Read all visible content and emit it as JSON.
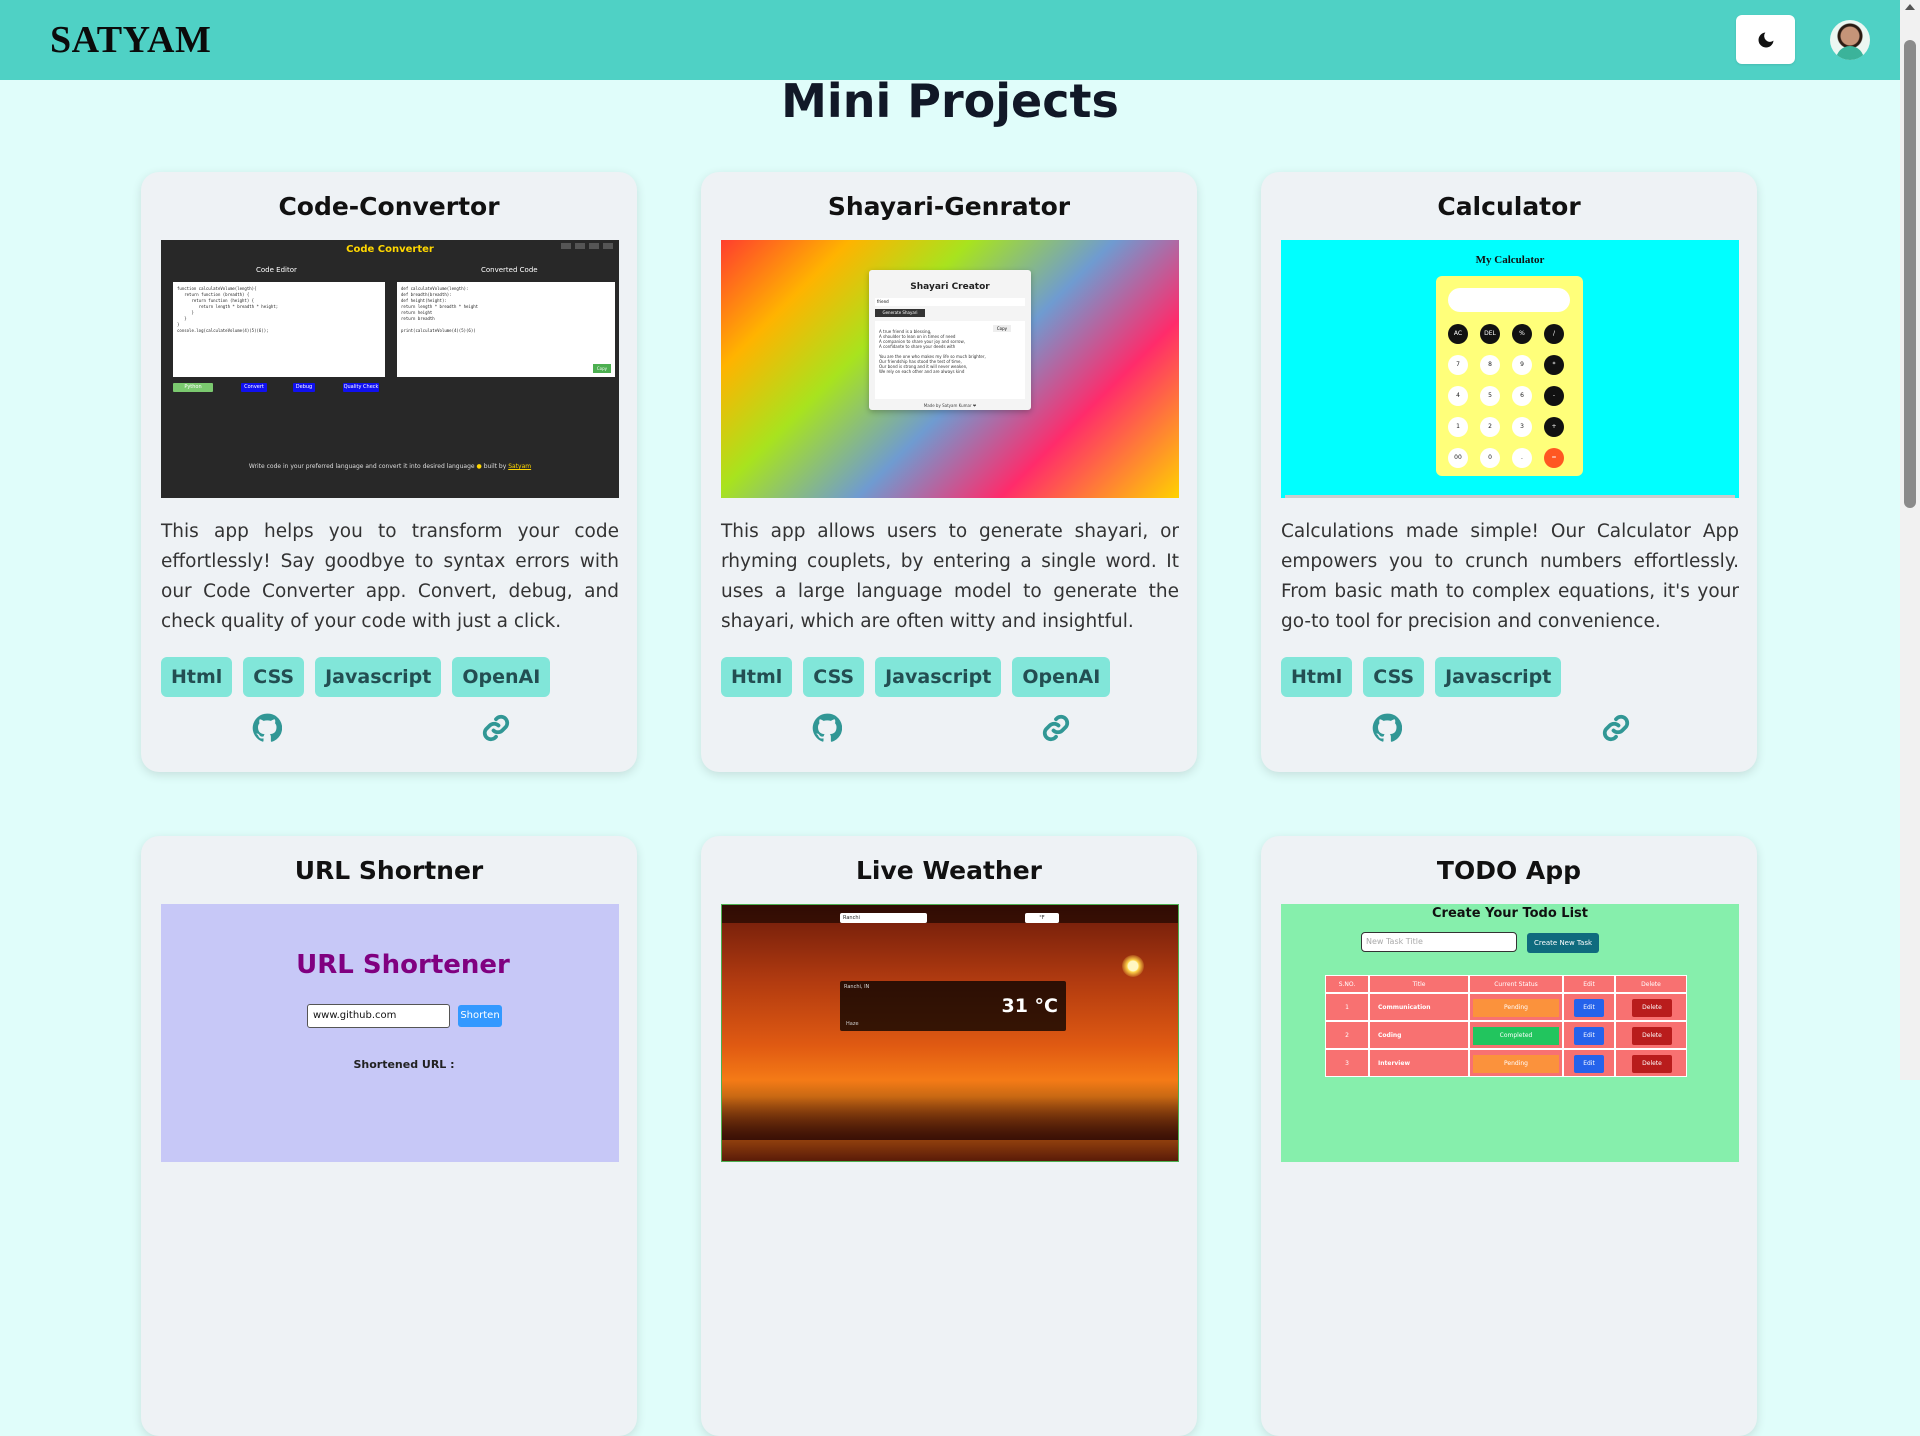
{
  "navbar": {
    "brand": "SATYAM",
    "theme_toggle": "moon-icon",
    "avatar": "avatar"
  },
  "page": {
    "title": "Mini Projects"
  },
  "cards": [
    {
      "title": "Code-Convertor",
      "description": "This app helps you to transform your code effortlessly! Say goodbye to syntax errors with our Code Converter app. Convert, debug, and check quality of your code with just a click.",
      "tags": [
        "Html",
        "CSS",
        "Javascript",
        "OpenAI"
      ],
      "preview": {
        "title": "Code Converter",
        "left_label": "Code Editor",
        "right_label": "Converted Code",
        "left_code": "function calculateVolume(length){\n   return function (breadth) {\n      return function (height) {\n         return length * breadth * height;\n      }\n   }\n}\nconsole.log(calculateVolume(4)(5)(6));",
        "right_code": "def calculateVolume(length):\ndef breadth(breadth):\ndef height(height):\nreturn length * breadth * height\nreturn height\nreturn breadth\n\nprint(calculateVolume(4)(5)(6))",
        "buttons": [
          "Python",
          "Convert",
          "Debug",
          "Quality Check"
        ],
        "copy": "Copy",
        "footer": "Write code in your preferred language and convert it into desired language",
        "footer_credit": "built by",
        "footer_author": "Satyam"
      }
    },
    {
      "title": "Shayari-Genrator",
      "description": "This app allows users to generate shayari, or rhyming couplets, by entering a single word. It uses a large language model to generate the shayari, which are often witty and insightful.",
      "tags": [
        "Html",
        "CSS",
        "Javascript",
        "OpenAI"
      ],
      "preview": {
        "title": "Shayari Creator",
        "input": "friend",
        "button": "Generate Shayari",
        "copy": "Copy",
        "lines": [
          "A true friend is a blessing,",
          "A shoulder to lean on in times of need",
          "A companion to share your joy and sorrow,",
          "A confidante to share your deeds with",
          "",
          "You are the one who makes my life so much brighter,",
          "Our friendship has stood the test of time,",
          "Our bond is strong and it will never weaken,",
          "We rely on each other and are always kind"
        ],
        "footer": "Made by Satyam Kumar ❤"
      }
    },
    {
      "title": "Calculator",
      "description": "Calculations made simple! Our Calculator App empowers you to crunch numbers effortlessly. From basic math to complex equations, it's your go-to tool for precision and convenience.",
      "tags": [
        "Html",
        "CSS",
        "Javascript"
      ],
      "preview": {
        "title": "My Calculator",
        "rows": [
          [
            "AC",
            "DEL",
            "%",
            "/"
          ],
          [
            "7",
            "8",
            "9",
            "*"
          ],
          [
            "4",
            "5",
            "6",
            "-"
          ],
          [
            "1",
            "2",
            "3",
            "+"
          ],
          [
            "00",
            "0",
            ".",
            "="
          ]
        ]
      }
    },
    {
      "title": "URL Shortner",
      "preview": {
        "title": "URL Shortener",
        "input": "www.github.com",
        "button": "Shorten",
        "result_label": "Shortened URL :"
      }
    },
    {
      "title": "Live Weather",
      "preview": {
        "search": "Ranchi",
        "unit": "°F",
        "location": "Ranchi, IN",
        "temp": "31 °C",
        "condition": "Haze"
      }
    },
    {
      "title": "TODO App",
      "preview": {
        "title": "Create Your Todo List",
        "placeholder": "New Task Title",
        "button": "Create New Task",
        "columns": [
          "S.NO.",
          "Title",
          "Current Status",
          "Edit",
          "Delete"
        ],
        "rows": [
          [
            "1",
            "Communication",
            "Pending",
            "Edit",
            "Delete"
          ],
          [
            "2",
            "Coding",
            "Completed",
            "Edit",
            "Delete"
          ],
          [
            "3",
            "Interview",
            "Pending",
            "Edit",
            "Delete"
          ]
        ]
      }
    }
  ],
  "colors": {
    "navbar": "#4fd1c5",
    "background": "#e0fdfa",
    "tag_bg": "#81e6d9",
    "tag_text": "#234e52",
    "icon": "#319795"
  }
}
